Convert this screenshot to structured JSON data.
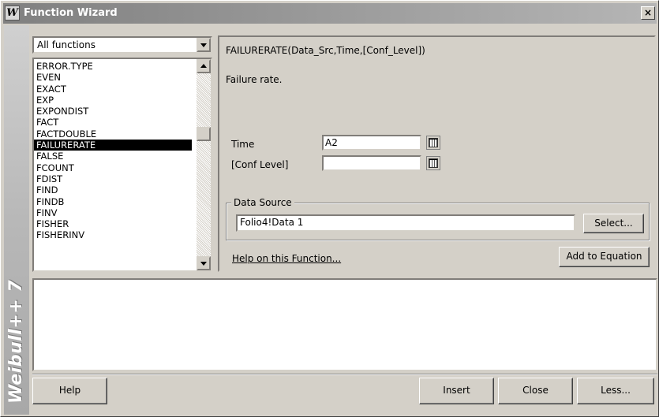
{
  "window": {
    "title": "Function Wizard",
    "icon_letter": "W",
    "close_glyph": "×"
  },
  "brand": {
    "text": "Weibull++ 7"
  },
  "category_select": {
    "value": "All functions"
  },
  "function_list": {
    "items": [
      "ERROR.TYPE",
      "EVEN",
      "EXACT",
      "EXP",
      "EXPONDIST",
      "FACT",
      "FACTDOUBLE",
      "FAILURERATE",
      "FALSE",
      "FCOUNT",
      "FDIST",
      "FIND",
      "FINDB",
      "FINV",
      "FISHER",
      "FISHERINV"
    ],
    "selected_index": 7
  },
  "details": {
    "syntax": "FAILURERATE(Data_Src,Time,[Conf_Level])",
    "description": "Failure rate.",
    "params": [
      {
        "label": "Time",
        "value": "A2"
      },
      {
        "label": "[Conf Level]",
        "value": ""
      }
    ],
    "data_source": {
      "legend": "Data Source",
      "value": "Folio4!Data 1",
      "select_label": "Select..."
    },
    "help_link": "Help on this Function...",
    "add_label": "Add to Equation"
  },
  "footer": {
    "help_label": "Help",
    "insert_label": "Insert",
    "close_label": "Close",
    "less_label": "Less..."
  }
}
